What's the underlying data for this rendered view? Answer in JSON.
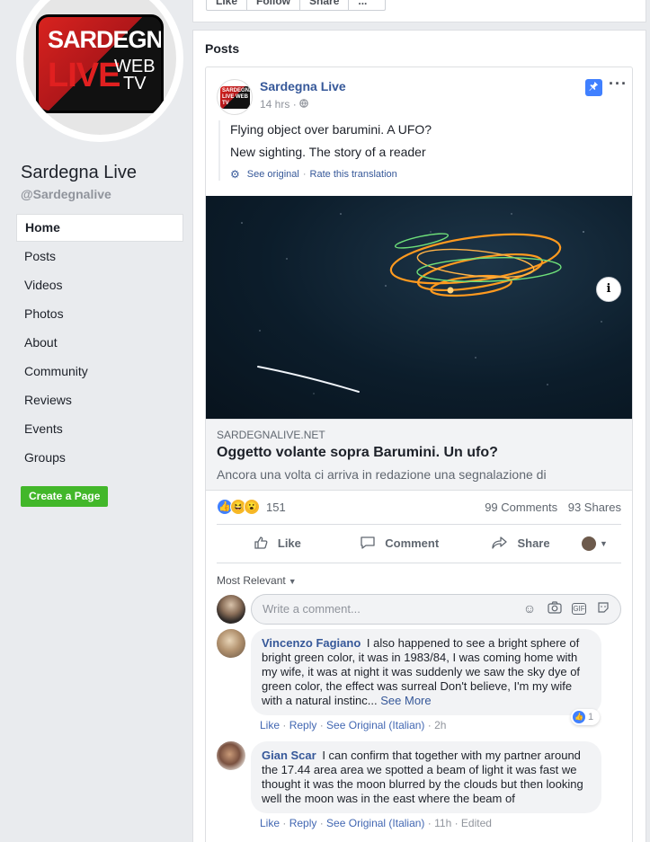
{
  "page": {
    "logo": {
      "line1": "SARDEGNA",
      "line2": "LIVE",
      "line3a": "WEB",
      "line3b": "TV"
    },
    "name": "Sardegna Live",
    "handle": "@Sardegnalive",
    "create_page_label": "Create a Page"
  },
  "top_buttons": [
    "Like",
    "Follow",
    "Share",
    "..."
  ],
  "nav": [
    {
      "label": "Home",
      "active": true
    },
    {
      "label": "Posts"
    },
    {
      "label": "Videos"
    },
    {
      "label": "Photos"
    },
    {
      "label": "About"
    },
    {
      "label": "Community"
    },
    {
      "label": "Reviews"
    },
    {
      "label": "Events"
    },
    {
      "label": "Groups"
    }
  ],
  "posts_section": {
    "title": "Posts",
    "post": {
      "author": "Sardegna Live",
      "time": "14 hrs",
      "avatar_text": "SARDEGNA LIVE WEB TV",
      "text_lines": [
        "Flying object over barumini. A UFO?",
        "New sighting. The story of a reader"
      ],
      "see_original": "See original",
      "separator": "·",
      "rate_translation": "Rate this translation",
      "link": {
        "domain": "SARDEGNALIVE.NET",
        "title": "Oggetto volante sopra Barumini. Un ufo?",
        "description": "Ancora una volta ci arriva in redazione una segnalazione di",
        "info": "i"
      },
      "reactions_count": "151",
      "comments_count": "99 Comments",
      "shares_count": "93 Shares",
      "actions": {
        "like": "Like",
        "comment": "Comment",
        "share": "Share"
      }
    }
  },
  "comments": {
    "sort_label": "Most Relevant",
    "input_placeholder": "Write a comment...",
    "items": [
      {
        "author": "Vincenzo Fagiano",
        "text": "I also happened to see a bright sphere of bright green color, it was in 1983/84, I was coming home with my wife, it was at night it was suddenly we saw the sky dye of green color, the effect was surreal Don't believe, I'm my wife with a natural instinc...",
        "see_more": "See More",
        "like": "Like",
        "reply": "Reply",
        "see_original": "See Original (Italian)",
        "time": "2h",
        "likes": "1"
      },
      {
        "author": "Gian Scar",
        "text": "I can confirm that together with my partner around the 17.44 area area we spotted a beam of light it was fast we thought it was the moon blurred by the clouds but then looking well the moon was in the east where the beam of",
        "like": "Like",
        "reply": "Reply",
        "see_original": "See Original (Italian)",
        "time": "11h",
        "edited": "Edited"
      }
    ]
  },
  "colors": {
    "link_blue": "#365899",
    "create_green": "#42b72a",
    "background": "#e9ebee",
    "ufo_orange": "#ff9a1f",
    "ufo_green": "#6ee07a"
  }
}
